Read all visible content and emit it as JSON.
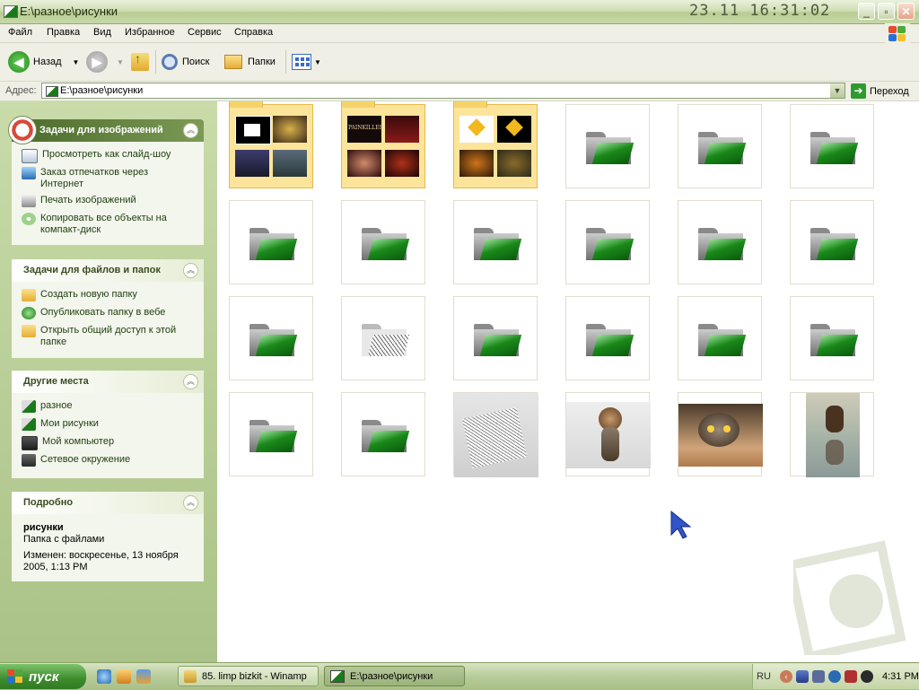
{
  "window": {
    "title": "E:\\разное\\рисунки",
    "clock_overlay": "23.11  16:31:02"
  },
  "menu": [
    "Файл",
    "Правка",
    "Вид",
    "Избранное",
    "Сервис",
    "Справка"
  ],
  "toolbar": {
    "back_label": "Назад",
    "search_label": "Поиск",
    "folders_label": "Папки"
  },
  "address": {
    "label": "Адрес:",
    "value": "E:\\разное\\рисунки",
    "go_label": "Переход"
  },
  "panels": {
    "image_tasks": {
      "title": "Задачи для изображений",
      "items": [
        "Просмотреть как слайд-шоу",
        "Заказ отпечатков через Интернет",
        "Печать изображений",
        "Копировать все объекты на компакт-диск"
      ]
    },
    "file_tasks": {
      "title": "Задачи для файлов и папок",
      "items": [
        "Создать новую папку",
        "Опубликовать папку в вебе",
        "Открыть общий доступ к этой папке"
      ]
    },
    "other_places": {
      "title": "Другие места",
      "items": [
        "разное",
        "Мои рисунки",
        "Мой компьютер",
        "Сетевое окружение"
      ]
    },
    "details": {
      "title": "Подробно",
      "name": "рисунки",
      "type": "Папка с файлами",
      "modified": "Изменен: воскресенье, 13 ноября 2005, 1:13 PM"
    }
  },
  "thumbnails": {
    "folder2_caption": "PAINKILLER"
  },
  "taskbar": {
    "start_label": "пуск",
    "tasks": [
      "85. limp bizkit - Winamp",
      "E:\\разное\\рисунки"
    ],
    "lang": "RU",
    "time": "4:31 PM"
  },
  "colors": {
    "accent_green": "#3c8c2c",
    "panel_bg": "#f3f6ec",
    "pane_bg": "#b9cf96"
  }
}
